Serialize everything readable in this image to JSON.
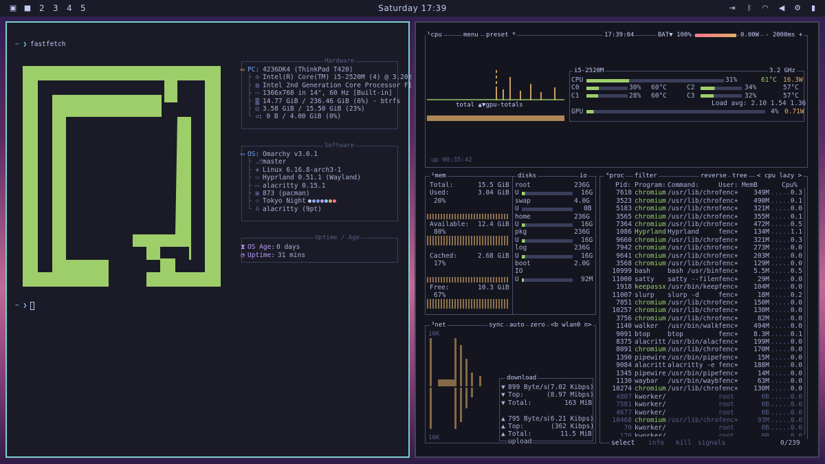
{
  "topbar": {
    "workspaces": [
      "2",
      "3",
      "4",
      "5"
    ],
    "clock": "Saturday 17:39",
    "icons": [
      "layout-icon",
      "square-icon",
      "logout-icon",
      "bluetooth-icon",
      "wifi-icon",
      "volume-icon",
      "settings-icon",
      "battery-icon"
    ]
  },
  "terminal": {
    "prompt1": "~ ❯",
    "cmd1": "fastfetch",
    "prompt2": "~ ❯",
    "logo_color": "#9ece6a",
    "hardware_title": "Hardware",
    "hardware": [
      {
        "k": "PC:",
        "v": "4236DK4 (ThinkPad T420)"
      },
      {
        "k": "",
        "v": "Intel(R) Core(TM) i5-2520M (4) @ 3.20z"
      },
      {
        "k": "",
        "v": "Intel 2nd Generation Core Processor F]"
      },
      {
        "k": "",
        "v": "1366x768 in 14\", 60 Hz [Built-in]"
      },
      {
        "k": "",
        "v": "14.77 GiB / 236.46 GiB (6%) - btrfs"
      },
      {
        "k": "",
        "v": "3.58 GiB / 15.50 GiB (23%)"
      },
      {
        "k": "",
        "v": ": 0 B / 4.00 GiB (0%)"
      }
    ],
    "software_title": "Software",
    "software": [
      {
        "k": "OS:",
        "v": "Omarchy v3.0.1"
      },
      {
        "k": "",
        "v": "master"
      },
      {
        "k": "",
        "v": "Linux 6.16.8-arch3-1"
      },
      {
        "k": "",
        "v": "Hyprland 0.51.1 (Wayland)"
      },
      {
        "k": "",
        "v": "alacritty 0.15.1"
      },
      {
        "k": "",
        "v": "873 (pacman)"
      },
      {
        "k": "",
        "v": "Tokyo Night"
      },
      {
        "k": "",
        "v": "alacritty (9pt)"
      }
    ],
    "uptime_title": "Uptime / Age",
    "osage_label": "OS Age:",
    "osage_value": "0 days",
    "uptime_label": "Uptime:",
    "uptime_value": "31 mins"
  },
  "btop": {
    "cpu_header": {
      "cpu": "¹cpu",
      "menu": "menu",
      "preset": "preset *",
      "time": "17:39:04",
      "bat": "BAT▼ 100%",
      "power": "0.00W",
      "interval": "- 2000ms +"
    },
    "cpu_box": {
      "model": "i5-2520M",
      "freq": "3.2 GHz",
      "cpu_pct": "31%",
      "cpu_temp": "61°C",
      "cpu_w": "16.3W",
      "cores": [
        {
          "n": "C0",
          "p": "30%",
          "t": "60°C"
        },
        {
          "n": "C2",
          "p": "34%",
          "t": "57°C"
        },
        {
          "n": "C1",
          "p": "28%",
          "t": "60°C"
        },
        {
          "n": "C3",
          "p": "32%",
          "t": "57°C"
        }
      ],
      "load": "Load avg: 2.10 1.54 1.36",
      "gpu_label": "GPU",
      "gpu_pct": "4%",
      "gpu_w": "0.71W"
    },
    "gpu_totals": "total ▲▼gpu-totals",
    "uptime": "up 00:35:42",
    "mem": {
      "title": "²mem",
      "total_label": "Total:",
      "total": "15.5 GiB",
      "used_label": "Used:",
      "used": "3.04 GiB",
      "used_pct": "20%",
      "avail_label": "Available:",
      "avail": "12.4 GiB",
      "avail_pct": "80%",
      "cached_label": "Cached:",
      "cached": "2.68 GiB",
      "cached_pct": "17%",
      "free_label": "Free:",
      "free": "10.3 GiB",
      "free_pct": "67%"
    },
    "disks": {
      "title": "disks",
      "io": "io",
      "items": [
        {
          "name": "root",
          "size": "236G",
          "u": "U",
          "v": "16G"
        },
        {
          "name": "swap",
          "size": "4.0G",
          "u": "U",
          "v": "0B"
        },
        {
          "name": "home",
          "size": "236G",
          "u": "U",
          "v": "16G"
        },
        {
          "name": "pkg",
          "size": "236G",
          "u": "U",
          "v": "16G"
        },
        {
          "name": "log",
          "size": "236G",
          "u": "U",
          "v": "16G"
        },
        {
          "name": "boot",
          "size": "2.0G",
          "u": "IO",
          "v": "92M"
        }
      ]
    },
    "net": {
      "title": "³net",
      "sync": "sync",
      "auto": "auto",
      "zero": "zero",
      "iface": "<b wlan0 n>",
      "scale_top": "10K",
      "scale_bot": "10K",
      "download": "download",
      "dl_rate": "899 Byte/s",
      "dl_bits": "(7.02 Kibps)",
      "dl_top_label": "Top:",
      "dl_top": "(8.97 Mibps)",
      "dl_total_label": "Total:",
      "dl_total": "163 MiB",
      "ul_rate": "795 Byte/s",
      "ul_bits": "(6.21 Kibps)",
      "ul_top_label": "Top:",
      "ul_top": "(362 Kibps)",
      "ul_total_label": "Total:",
      "ul_total": "11.5 MiB",
      "upload": "upload"
    },
    "proc": {
      "title": "⁴proc",
      "filter": "filter",
      "reverse": "reverse",
      "tree": "tree",
      "mode": "< cpu lazy >",
      "cols": [
        "Pid:",
        "Program:",
        "Command:",
        "User:",
        "MemB",
        "Cpu%"
      ],
      "rows": [
        [
          "7618",
          "chromium",
          "/usr/lib/chro",
          "fenc+",
          "349M",
          "0.3"
        ],
        [
          "3523",
          "chromium",
          "/usr/lib/chro",
          "fenc+",
          "490M",
          "0.1"
        ],
        [
          "5183",
          "chromium",
          "/usr/lib/chro",
          "fenc+",
          "321M",
          "0.0"
        ],
        [
          "3565",
          "chromium",
          "/usr/lib/chro",
          "fenc+",
          "355M",
          "0.1"
        ],
        [
          "7364",
          "chromium",
          "/usr/lib/chro",
          "fenc+",
          "472M",
          "0.5"
        ],
        [
          "1086",
          "Hyprland",
          "Hyprland",
          "fenc+",
          "134M",
          "1.1"
        ],
        [
          "9660",
          "chromium",
          "/usr/lib/chro",
          "fenc+",
          "321M",
          "0.3"
        ],
        [
          "7942",
          "chromium",
          "/usr/lib/chro",
          "fenc+",
          "273M",
          "0.0"
        ],
        [
          "9641",
          "chromium",
          "/usr/lib/chro",
          "fenc+",
          "203M",
          "0.0"
        ],
        [
          "3568",
          "chromium",
          "/usr/lib/chro",
          "fenc+",
          "129M",
          "0.0"
        ],
        [
          "10999",
          "bash",
          "bash /usr/bin",
          "fenc+",
          "5.5M",
          "0.5"
        ],
        [
          "11000",
          "satty",
          "satty --filen",
          "fenc+",
          "29M",
          "0.0"
        ],
        [
          "1918",
          "keepassx",
          "/usr/bin/keep",
          "fenc+",
          "104M",
          "0.0"
        ],
        [
          "11007",
          "slurp",
          "slurp -d",
          "fenc+",
          "18M",
          "0.2"
        ],
        [
          "7851",
          "chromium",
          "/usr/lib/chro",
          "fenc+",
          "150M",
          "0.0"
        ],
        [
          "10257",
          "chromium",
          "/usr/lib/chro",
          "fenc+",
          "130M",
          "0.0"
        ],
        [
          "3756",
          "chromium",
          "/usr/lib/chro",
          "fenc+",
          "82M",
          "0.0"
        ],
        [
          "1140",
          "walker",
          "/usr/bin/walk",
          "fenc+",
          "494M",
          "0.0"
        ],
        [
          "9091",
          "btop",
          "btop",
          "fenc+",
          "8.3M",
          "0.1"
        ],
        [
          "8375",
          "alacritt",
          "/usr/bin/alac",
          "fenc+",
          "199M",
          "0.0"
        ],
        [
          "8091",
          "chromium",
          "/usr/lib/chro",
          "fenc+",
          "170M",
          "0.0"
        ],
        [
          "1390",
          "pipewire",
          "/usr/bin/pipe",
          "fenc+",
          "15M",
          "0.0"
        ],
        [
          "9084",
          "alacritt",
          "alacritty -e",
          "fenc+",
          "188M",
          "0.0"
        ],
        [
          "1345",
          "pipewire",
          "/usr/bin/pipe",
          "fenc+",
          "14M",
          "0.0"
        ],
        [
          "1130",
          "waybar",
          "/usr/bin/wayb",
          "fenc+",
          "63M",
          "0.0"
        ],
        [
          "10274",
          "chromium",
          "/usr/lib/chro",
          "fenc+",
          "130M",
          "0.0"
        ],
        [
          "4807",
          "kworker/",
          "",
          "root",
          "0B",
          "0.0"
        ],
        [
          "7581",
          "kworker/",
          "",
          "root",
          "0B",
          "0.0"
        ],
        [
          "4677",
          "kworker/",
          "",
          "root",
          "0B",
          "0.0"
        ],
        [
          "10468",
          "chromium",
          "/usr/lib/chro",
          "fenc+",
          "93M",
          "0.0"
        ],
        [
          "70",
          "kworker/",
          "",
          "root",
          "0B",
          "0.0"
        ],
        [
          "170",
          "kworker/",
          "",
          "root",
          "0B",
          "0.0"
        ]
      ],
      "footer_select": "select",
      "footer_info": "info",
      "footer_kill": "kill",
      "footer_signals": "signals",
      "footer_count": "0/239"
    }
  }
}
